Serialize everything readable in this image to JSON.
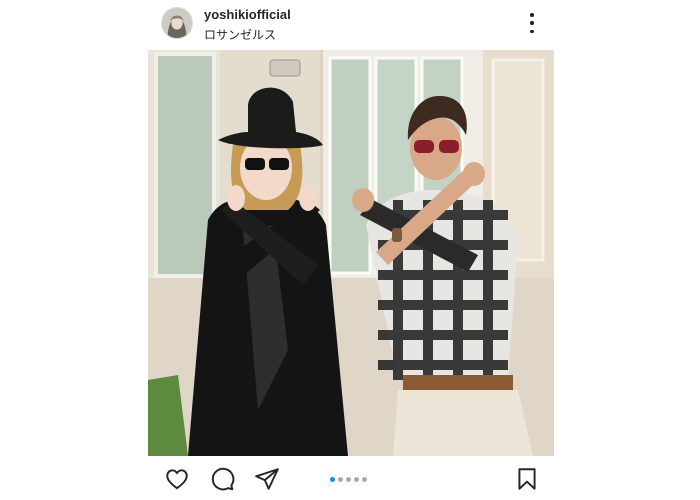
{
  "header": {
    "username": "yoshikiofficial",
    "location": "ロサンゼルス",
    "avatar_icon": "profile-avatar",
    "more_icon": "more-vertical-icon"
  },
  "photo": {
    "description_icon": "post-photo"
  },
  "actions": {
    "like_icon": "heart-icon",
    "comment_icon": "comment-icon",
    "share_icon": "send-icon",
    "save_icon": "bookmark-icon",
    "carousel": {
      "total": 5,
      "active_index": 0
    }
  },
  "colors": {
    "accent": "#0095f6",
    "text": "#262626",
    "inactive_dot": "#a8a8a8"
  }
}
